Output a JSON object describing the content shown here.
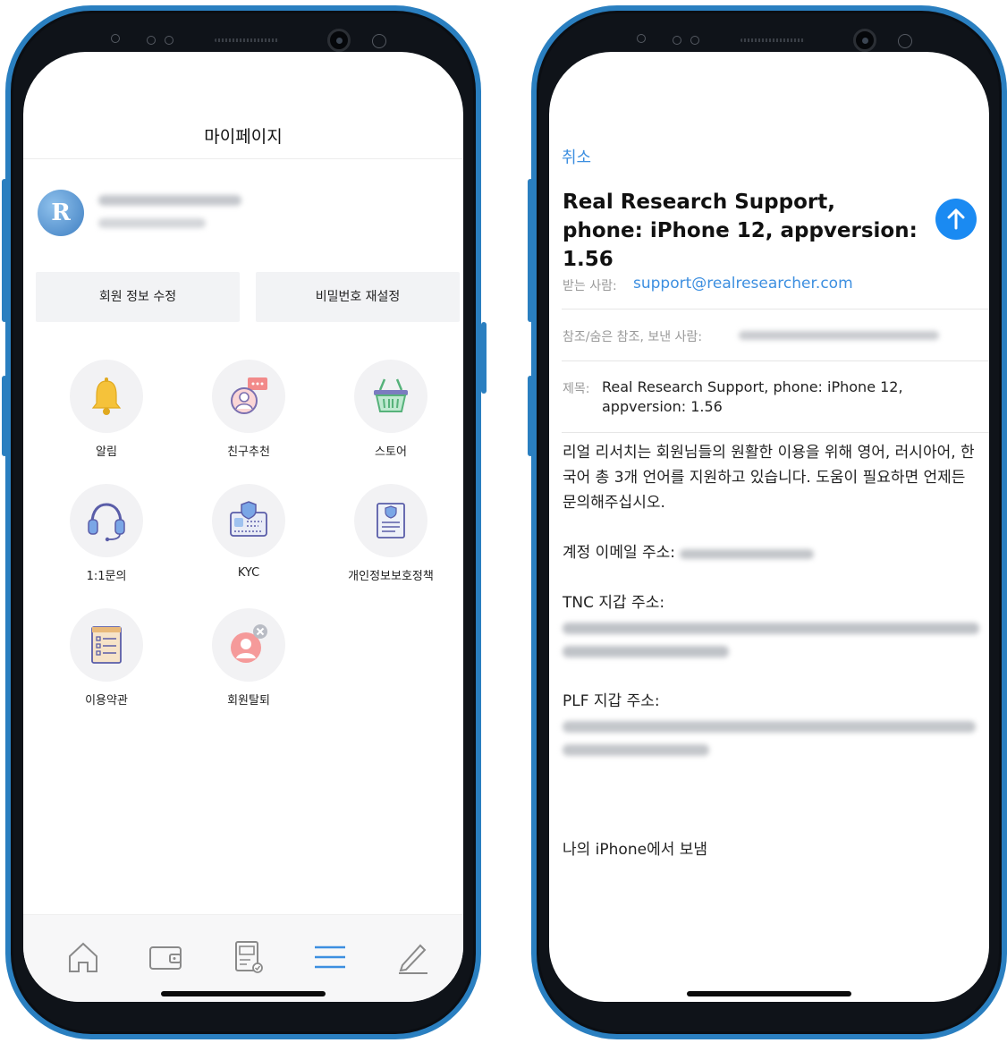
{
  "left_screen": {
    "header_title": "마이페이지",
    "profile_avatar_letter": "R",
    "buttons": {
      "edit_info": "회원 정보 수정",
      "reset_password": "비밀번호 재설정"
    },
    "menu": [
      {
        "label": "알림",
        "icon": "bell-icon"
      },
      {
        "label": "친구추천",
        "icon": "refer-friend-icon"
      },
      {
        "label": "스토어",
        "icon": "store-basket-icon"
      },
      {
        "label": "1:1문의",
        "icon": "headset-icon"
      },
      {
        "label": "KYC",
        "icon": "kyc-card-icon"
      },
      {
        "label": "개인정보보호정책",
        "icon": "privacy-policy-icon"
      },
      {
        "label": "이용약관",
        "icon": "terms-list-icon"
      },
      {
        "label": "회원탈퇴",
        "icon": "withdraw-member-icon"
      }
    ],
    "tabbar": [
      "home-icon",
      "wallet-icon",
      "survey-icon",
      "menu-icon",
      "pencil-icon"
    ],
    "active_tab": "menu-icon"
  },
  "right_screen": {
    "cancel_label": "취소",
    "subject_title": "Real Research Support, phone: iPhone 12, appversion: 1.56",
    "to": {
      "key": "받는 사람:",
      "value": "support@realresearcher.com"
    },
    "cc": {
      "key": "참조/숨은 참조, 보낸 사람:"
    },
    "subject_row": {
      "key": "제목:",
      "value": "Real Research Support, phone: iPhone 12, appversion: 1.56"
    },
    "body": {
      "intro": "리얼 리서치는 회원님들의 원활한 이용을 위해 영어, 러시아어, 한국어 총 3개 언어를 지원하고 있습니다. 도움이 필요하면 언제든 문의해주십시오.",
      "account_email_label": "계정 이메일 주소:",
      "tnc_label": "TNC 지갑 주소:",
      "plf_label": "PLF 지갑 주소:",
      "signature": "나의 iPhone에서 보냄"
    },
    "accent_color": "#1a8af2",
    "link_color": "#3d8fe0"
  }
}
